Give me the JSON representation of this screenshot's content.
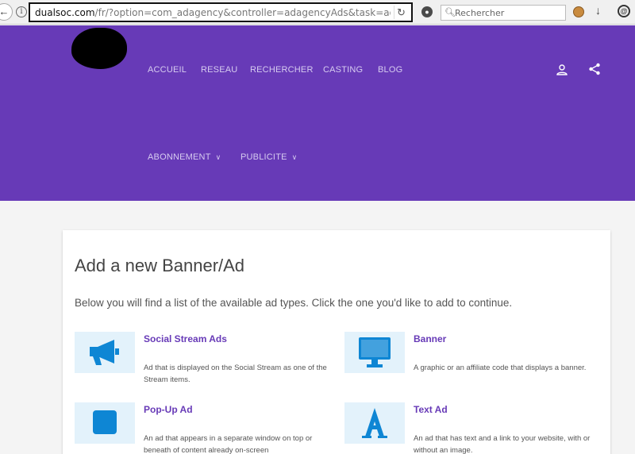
{
  "browser": {
    "url_domain": "dualsoc.com",
    "url_path": "/fr/?option=com_adagency&controller=adagencyAds&task=addbanners",
    "search_placeholder": "Rechercher"
  },
  "nav": {
    "items": [
      {
        "label": "ACCUEIL"
      },
      {
        "label": "RESEAU"
      },
      {
        "label": "RECHERCHER"
      },
      {
        "label": "CASTING"
      },
      {
        "label": "BLOG"
      },
      {
        "label": "ABONNEMENT"
      },
      {
        "label": "PUBLICITE"
      }
    ]
  },
  "content": {
    "title": "Add a new Banner/Ad",
    "description": "Below you will find a list of the available ad types. Click the one you'd like to add to continue.",
    "ad_types": [
      {
        "title": "Social Stream Ads",
        "description": "Ad that is displayed on the Social Stream as one of the Stream items.",
        "icon": "megaphone-icon"
      },
      {
        "title": "Banner",
        "description": "A graphic or an affiliate code that displays a banner.",
        "icon": "monitor-icon"
      },
      {
        "title": "Pop-Up Ad",
        "description": "An ad that appears in a separate window on top or beneath of content already on-screen",
        "icon": "square-icon"
      },
      {
        "title": "Text Ad",
        "description": "An ad that has text and a link to your website, with or without an image.",
        "icon": "letter-a-icon"
      }
    ]
  },
  "colors": {
    "header": "#673ab7",
    "accent": "#673ab7",
    "icon_blue": "#0e86d4",
    "icon_bg": "#e3f2fb"
  }
}
